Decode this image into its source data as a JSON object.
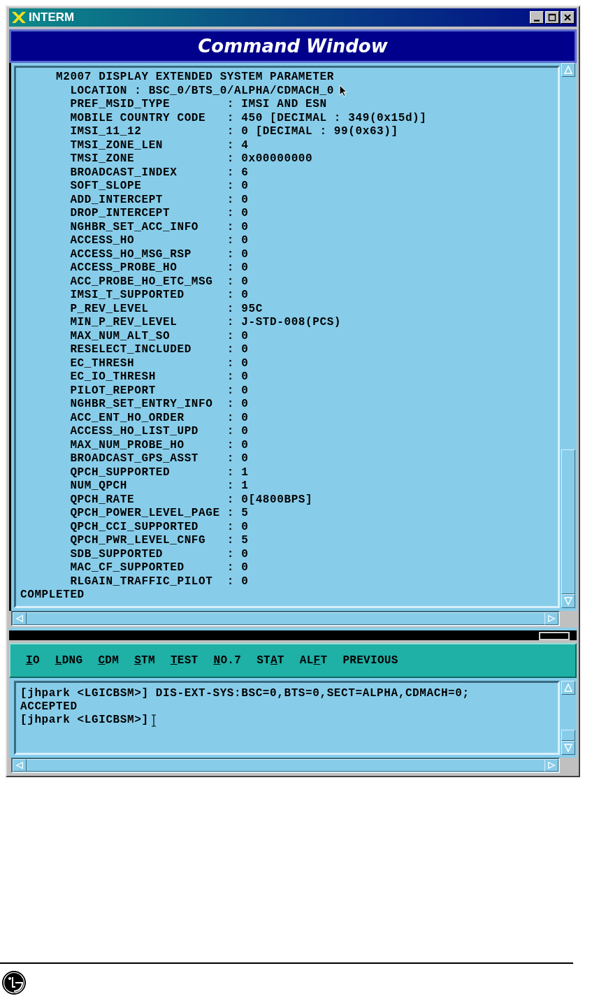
{
  "window": {
    "title": "INTERM"
  },
  "panel_title": "Command Window",
  "output": {
    "lines": [
      "     M2007 DISPLAY EXTENDED SYSTEM PARAMETER",
      "       LOCATION : BSC_0/BTS_0/ALPHA/CDMACH_0",
      "       PREF_MSID_TYPE        : IMSI AND ESN",
      "       MOBILE COUNTRY CODE   : 450 [DECIMAL : 349(0x15d)]",
      "       IMSI_11_12            : 0 [DECIMAL : 99(0x63)]",
      "       TMSI_ZONE_LEN         : 4",
      "       TMSI_ZONE             : 0x00000000",
      "       BROADCAST_INDEX       : 6",
      "       SOFT_SLOPE            : 0",
      "       ADD_INTERCEPT         : 0",
      "       DROP_INTERCEPT        : 0",
      "       NGHBR_SET_ACC_INFO    : 0",
      "       ACCESS_HO             : 0",
      "       ACCESS_HO_MSG_RSP     : 0",
      "       ACCESS_PROBE_HO       : 0",
      "       ACC_PROBE_HO_ETC_MSG  : 0",
      "       IMSI_T_SUPPORTED      : 0",
      "       P_REV_LEVEL           : 95C",
      "       MIN_P_REV_LEVEL       : J-STD-008(PCS)",
      "       MAX_NUM_ALT_SO        : 0",
      "       RESELECT_INCLUDED     : 0",
      "       EC_THRESH             : 0",
      "       EC_IO_THRESH          : 0",
      "       PILOT_REPORT          : 0",
      "       NGHBR_SET_ENTRY_INFO  : 0",
      "       ACC_ENT_HO_ORDER      : 0",
      "       ACCESS_HO_LIST_UPD    : 0",
      "       MAX_NUM_PROBE_HO      : 0",
      "       BROADCAST_GPS_ASST    : 0",
      "       QPCH_SUPPORTED        : 1",
      "       NUM_QPCH              : 1",
      "       QPCH_RATE             : 0[4800BPS]",
      "       QPCH_POWER_LEVEL_PAGE : 5",
      "       QPCH_CCI_SUPPORTED    : 0",
      "       QPCH_PWR_LEVEL_CNFG   : 5",
      "       SDB_SUPPORTED         : 0",
      "       MAC_CF_SUPPORTED      : 0",
      "       RLGAIN_TRAFFIC_PILOT  : 0",
      "COMPLETED"
    ]
  },
  "menu": [
    {
      "key": "I",
      "after": "O"
    },
    {
      "key": "L",
      "after": "DNG"
    },
    {
      "key": "C",
      "after": "DM"
    },
    {
      "key": "S",
      "after": "TM"
    },
    {
      "key": "T",
      "after": "EST"
    },
    {
      "key": "N",
      "after": "O.7"
    },
    {
      "before": "ST",
      "key": "A",
      "after": "T"
    },
    {
      "before": "AL",
      "key": "F",
      "after": "T"
    },
    {
      "before": "PREVIOUS"
    }
  ],
  "console": {
    "lines": [
      "[jhpark <LGICBSM>] DIS-EXT-SYS:BSC=0,BTS=0,SECT=ALPHA,CDMACH=0;",
      "ACCEPTED",
      "[jhpark <LGICBSM>]"
    ]
  }
}
